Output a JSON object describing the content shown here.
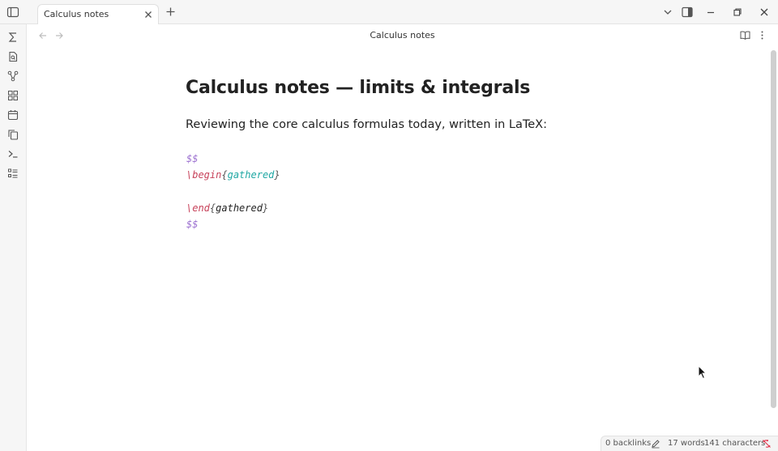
{
  "tab": {
    "label": "Calculus notes"
  },
  "view_header": {
    "title": "Calculus notes"
  },
  "note": {
    "title": "Calculus notes — limits & integrals",
    "paragraph": "Reviewing the core calculus formulas today, written in LaTeX:",
    "code": {
      "open_delim": "$$",
      "begin_cmd": "\\begin",
      "begin_env": "gathered",
      "end_cmd": "\\end",
      "end_env": "gathered",
      "close_delim": "$$",
      "brace_open": "{",
      "brace_close": "}"
    }
  },
  "status": {
    "backlinks": "0 backlinks",
    "words": "17 words",
    "characters": "141 characters"
  },
  "icons": {
    "sidebar_toggle": "sidebar-toggle-icon",
    "ribbon": [
      "sigma-icon",
      "file-search-icon",
      "graph-icon",
      "grid-icon",
      "calendar-icon",
      "copy-icon",
      "terminal-icon",
      "list-icon"
    ]
  },
  "colors": {
    "latex_delimiter": "#9b6fd0",
    "latex_command": "#c7425a",
    "latex_env": "#1fa7a3",
    "status_warning": "#e0344c"
  }
}
